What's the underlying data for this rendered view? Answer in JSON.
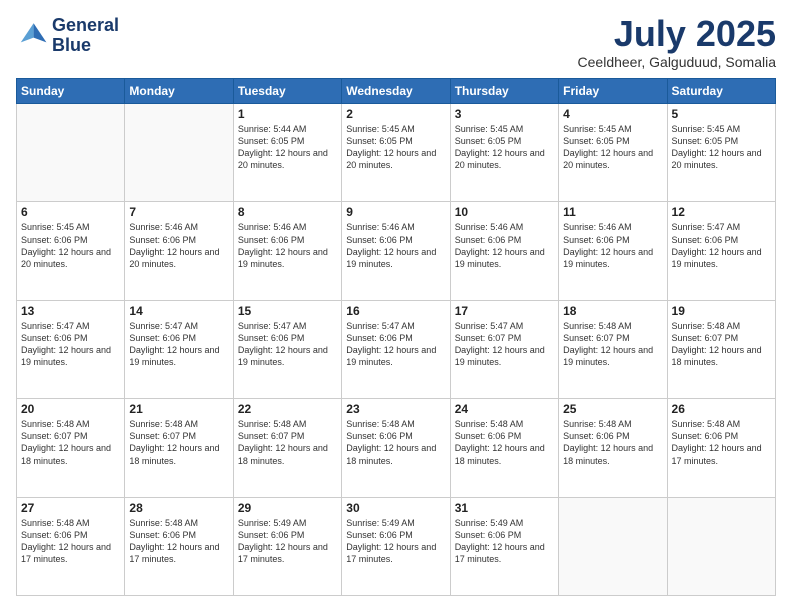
{
  "header": {
    "logo_line1": "General",
    "logo_line2": "Blue",
    "month": "July 2025",
    "location": "Ceeldheer, Galguduud, Somalia"
  },
  "days_of_week": [
    "Sunday",
    "Monday",
    "Tuesday",
    "Wednesday",
    "Thursday",
    "Friday",
    "Saturday"
  ],
  "weeks": [
    [
      {
        "day": "",
        "info": ""
      },
      {
        "day": "",
        "info": ""
      },
      {
        "day": "1",
        "info": "Sunrise: 5:44 AM\nSunset: 6:05 PM\nDaylight: 12 hours and 20 minutes."
      },
      {
        "day": "2",
        "info": "Sunrise: 5:45 AM\nSunset: 6:05 PM\nDaylight: 12 hours and 20 minutes."
      },
      {
        "day": "3",
        "info": "Sunrise: 5:45 AM\nSunset: 6:05 PM\nDaylight: 12 hours and 20 minutes."
      },
      {
        "day": "4",
        "info": "Sunrise: 5:45 AM\nSunset: 6:05 PM\nDaylight: 12 hours and 20 minutes."
      },
      {
        "day": "5",
        "info": "Sunrise: 5:45 AM\nSunset: 6:05 PM\nDaylight: 12 hours and 20 minutes."
      }
    ],
    [
      {
        "day": "6",
        "info": "Sunrise: 5:45 AM\nSunset: 6:06 PM\nDaylight: 12 hours and 20 minutes."
      },
      {
        "day": "7",
        "info": "Sunrise: 5:46 AM\nSunset: 6:06 PM\nDaylight: 12 hours and 20 minutes."
      },
      {
        "day": "8",
        "info": "Sunrise: 5:46 AM\nSunset: 6:06 PM\nDaylight: 12 hours and 19 minutes."
      },
      {
        "day": "9",
        "info": "Sunrise: 5:46 AM\nSunset: 6:06 PM\nDaylight: 12 hours and 19 minutes."
      },
      {
        "day": "10",
        "info": "Sunrise: 5:46 AM\nSunset: 6:06 PM\nDaylight: 12 hours and 19 minutes."
      },
      {
        "day": "11",
        "info": "Sunrise: 5:46 AM\nSunset: 6:06 PM\nDaylight: 12 hours and 19 minutes."
      },
      {
        "day": "12",
        "info": "Sunrise: 5:47 AM\nSunset: 6:06 PM\nDaylight: 12 hours and 19 minutes."
      }
    ],
    [
      {
        "day": "13",
        "info": "Sunrise: 5:47 AM\nSunset: 6:06 PM\nDaylight: 12 hours and 19 minutes."
      },
      {
        "day": "14",
        "info": "Sunrise: 5:47 AM\nSunset: 6:06 PM\nDaylight: 12 hours and 19 minutes."
      },
      {
        "day": "15",
        "info": "Sunrise: 5:47 AM\nSunset: 6:06 PM\nDaylight: 12 hours and 19 minutes."
      },
      {
        "day": "16",
        "info": "Sunrise: 5:47 AM\nSunset: 6:06 PM\nDaylight: 12 hours and 19 minutes."
      },
      {
        "day": "17",
        "info": "Sunrise: 5:47 AM\nSunset: 6:07 PM\nDaylight: 12 hours and 19 minutes."
      },
      {
        "day": "18",
        "info": "Sunrise: 5:48 AM\nSunset: 6:07 PM\nDaylight: 12 hours and 19 minutes."
      },
      {
        "day": "19",
        "info": "Sunrise: 5:48 AM\nSunset: 6:07 PM\nDaylight: 12 hours and 18 minutes."
      }
    ],
    [
      {
        "day": "20",
        "info": "Sunrise: 5:48 AM\nSunset: 6:07 PM\nDaylight: 12 hours and 18 minutes."
      },
      {
        "day": "21",
        "info": "Sunrise: 5:48 AM\nSunset: 6:07 PM\nDaylight: 12 hours and 18 minutes."
      },
      {
        "day": "22",
        "info": "Sunrise: 5:48 AM\nSunset: 6:07 PM\nDaylight: 12 hours and 18 minutes."
      },
      {
        "day": "23",
        "info": "Sunrise: 5:48 AM\nSunset: 6:06 PM\nDaylight: 12 hours and 18 minutes."
      },
      {
        "day": "24",
        "info": "Sunrise: 5:48 AM\nSunset: 6:06 PM\nDaylight: 12 hours and 18 minutes."
      },
      {
        "day": "25",
        "info": "Sunrise: 5:48 AM\nSunset: 6:06 PM\nDaylight: 12 hours and 18 minutes."
      },
      {
        "day": "26",
        "info": "Sunrise: 5:48 AM\nSunset: 6:06 PM\nDaylight: 12 hours and 17 minutes."
      }
    ],
    [
      {
        "day": "27",
        "info": "Sunrise: 5:48 AM\nSunset: 6:06 PM\nDaylight: 12 hours and 17 minutes."
      },
      {
        "day": "28",
        "info": "Sunrise: 5:48 AM\nSunset: 6:06 PM\nDaylight: 12 hours and 17 minutes."
      },
      {
        "day": "29",
        "info": "Sunrise: 5:49 AM\nSunset: 6:06 PM\nDaylight: 12 hours and 17 minutes."
      },
      {
        "day": "30",
        "info": "Sunrise: 5:49 AM\nSunset: 6:06 PM\nDaylight: 12 hours and 17 minutes."
      },
      {
        "day": "31",
        "info": "Sunrise: 5:49 AM\nSunset: 6:06 PM\nDaylight: 12 hours and 17 minutes."
      },
      {
        "day": "",
        "info": ""
      },
      {
        "day": "",
        "info": ""
      }
    ]
  ]
}
